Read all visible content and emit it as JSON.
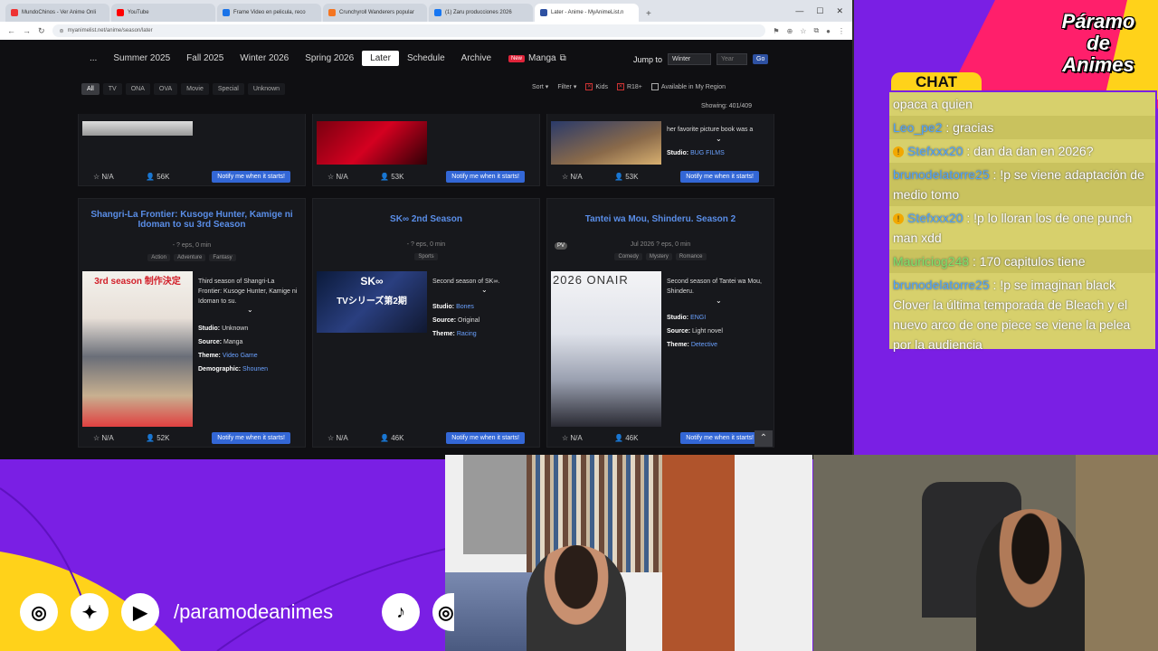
{
  "browser": {
    "tabs": [
      {
        "label": "MundoChinos - Ver Anime Onli",
        "color": "#e33"
      },
      {
        "label": "YouTube",
        "color": "#f00"
      },
      {
        "label": "Frame Video en pelicula, reco",
        "color": "#1a73e8"
      },
      {
        "label": "Crunchyroll Wanderers popular",
        "color": "#f47521"
      },
      {
        "label": "(1) Zaru producciones 2026",
        "color": "#1877f2"
      },
      {
        "label": "Later - Anime - MyAnimeList.n",
        "color": "#2e51a2"
      }
    ],
    "new_tab": "+",
    "url": "myanimelist.net/anime/season/later"
  },
  "season_nav": {
    "items": [
      "...",
      "Summer 2025",
      "Fall 2025",
      "Winter 2026",
      "Spring 2026",
      "Later",
      "Schedule",
      "Archive"
    ],
    "active": "Later",
    "manga_badge": "New",
    "manga_label": "Manga",
    "jump_label": "Jump to",
    "jump_season": "Winter",
    "jump_year_placeholder": "Year",
    "go_label": "Go"
  },
  "filters": {
    "types": [
      "All",
      "TV",
      "ONA",
      "OVA",
      "Movie",
      "Special",
      "Unknown"
    ],
    "active": "All",
    "sort": "Sort",
    "filter": "Filter",
    "kids": "Kids",
    "r18": "R18+",
    "available": "Available in My Region",
    "showing": "Showing: 401/409"
  },
  "top_row": [
    {
      "score": "N/A",
      "members": "56K",
      "notify": "Notify me when it starts!"
    },
    {
      "score": "N/A",
      "members": "53K",
      "notify": "Notify me when it starts!"
    },
    {
      "score": "N/A",
      "members": "53K",
      "notify": "Notify me when it starts!",
      "synopsis": "her favorite picture book was a",
      "studio_label": "Studio:",
      "studio": "BUG FILMS"
    }
  ],
  "cards": [
    {
      "title": "Shangri-La Frontier: Kusoge Hunter, Kamige ni Idoman to su 3rd Season",
      "meta": "-     ? eps, 0 min",
      "genres": [
        "Action",
        "Adventure",
        "Fantasy"
      ],
      "poster_text": "3rd season 制作決定",
      "synopsis": "Third season of Shangri-La Frontier: Kusoge Hunter, Kamige ni Idoman to su.",
      "studio": "Unknown",
      "source": "Manga",
      "theme": "Video Game",
      "demographic": "Shounen",
      "score": "N/A",
      "members": "52K",
      "notify": "Notify me when it starts!"
    },
    {
      "title": "SK∞ 2nd Season",
      "meta": "-     ? eps, 0 min",
      "genres": [
        "Sports"
      ],
      "poster_text": "TVシリーズ第2期",
      "poster_logo": "SK∞",
      "synopsis": "Second season of SK∞.",
      "studio": "Bones",
      "source": "Original",
      "theme": "Racing",
      "score": "N/A",
      "members": "46K",
      "notify": "Notify me when it starts!"
    },
    {
      "title": "Tantei wa Mou, Shinderu. Season 2",
      "meta": "Jul 2026     ? eps, 0 min",
      "genres": [
        "Comedy",
        "Mystery",
        "Romance"
      ],
      "pv": "PV",
      "poster_text": "2026 ONAIR",
      "synopsis": "Second season of Tantei wa Mou, Shinderu.",
      "studio": "ENGI",
      "source": "Light novel",
      "theme": "Detective",
      "score": "N/A",
      "members": "46K",
      "notify": "Notify me when it starts!"
    }
  ],
  "labels": {
    "studio": "Studio:",
    "source": "Source:",
    "theme": "Theme:",
    "demographic": "Demographic:"
  },
  "brand": {
    "line1": "Páramo",
    "line2": "de",
    "line3": "Animes"
  },
  "chat": {
    "header": "CHAT",
    "messages": [
      {
        "user": "",
        "text": "opaca a quien",
        "badge": false
      },
      {
        "user": "Leo_pe2",
        "text": ": gracias",
        "badge": false
      },
      {
        "user": "Stefxxx20",
        "text": ": dan da dan en 2026?",
        "badge": true
      },
      {
        "user": "brunodelatorre25",
        "text": ": !p se viene adaptación de medio tomo",
        "badge": false
      },
      {
        "user": "Stefxxx20",
        "text": ": !p lo lloran los de one punch man xdd",
        "badge": true
      },
      {
        "user": "Mauriciog248",
        "text": ": 170 capitulos tiene",
        "badge": false
      },
      {
        "user": "brunodelatorre25",
        "text": ": !p se imaginan black Clover la última temporada de Bleach y el nuevo arco de one piece se viene la pelea por la audiencia",
        "badge": false
      }
    ]
  },
  "social": {
    "handle": "/paramodeanimes"
  },
  "colors": {
    "purple": "#7a1fe4",
    "pink": "#ff1f6b",
    "yellow": "#ffd21a",
    "mal_blue": "#2e51a2"
  }
}
